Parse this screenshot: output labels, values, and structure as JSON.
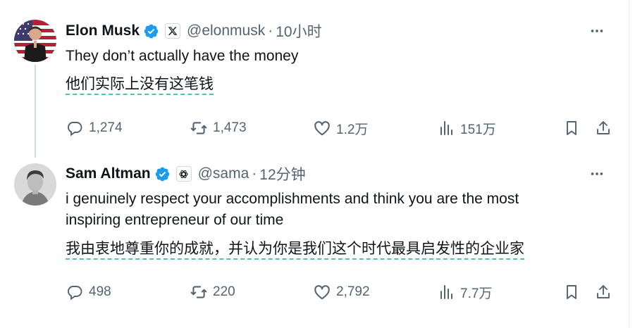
{
  "tweets": [
    {
      "name": "Elon Musk",
      "handle": "@elonmusk",
      "separator": "·",
      "time": "10小时",
      "text": "They don’t actually have the money",
      "translation": "他们实际上没有这笔钱",
      "stats": {
        "replies": "1,274",
        "reposts": "1,473",
        "likes": "1.2万",
        "views": "151万"
      },
      "affiliate_icon": "x-logo-icon",
      "avatar_icon": "elon-avatar-with-flag"
    },
    {
      "name": "Sam Altman",
      "handle": "@sama",
      "separator": "·",
      "time": "12分钟",
      "text": "i genuinely respect your accomplishments and think you are the most inspiring entrepreneur of our time",
      "translation": "我由衷地尊重你的成就，并认为你是我们这个时代最具启发性的企业家",
      "stats": {
        "replies": "498",
        "reposts": "220",
        "likes": "2,792",
        "views": "7.7万"
      },
      "affiliate_icon": "openai-logo-icon",
      "avatar_icon": "sam-avatar-photo"
    }
  ],
  "colors": {
    "verified": "#1d9bf0",
    "muted": "#536471",
    "translation_underline": "#52c1b4",
    "thread_line": "#cfd9de"
  },
  "icons": [
    "verified-badge-icon",
    "more-icon",
    "reply-icon",
    "repost-icon",
    "like-icon",
    "views-icon",
    "bookmark-icon",
    "share-icon"
  ]
}
